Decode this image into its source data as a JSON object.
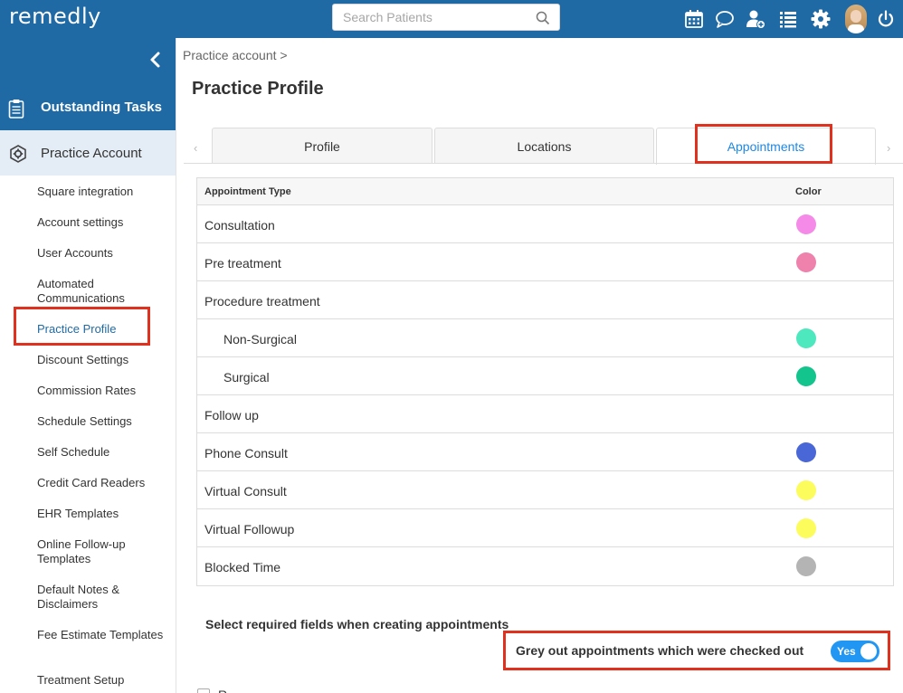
{
  "app": {
    "logo": "remedly"
  },
  "search": {
    "placeholder": "Search Patients"
  },
  "sidebar": {
    "outstanding_tasks": "Outstanding Tasks",
    "practice_account": "Practice Account",
    "items": [
      "Square integration",
      "Account settings",
      "User Accounts",
      "Automated Communications",
      "Practice Profile",
      "Discount Settings",
      "Commission Rates",
      "Schedule Settings",
      "Self Schedule",
      "Credit Card Readers",
      "EHR Templates",
      "Online Follow-up Templates",
      "Default Notes & Disclaimers",
      "Fee Estimate Templates",
      "Treatment Setup"
    ],
    "active_item": "Practice Profile"
  },
  "breadcrumb": "Practice account  >",
  "page_title": "Practice Profile",
  "tabs": [
    {
      "label": "Profile",
      "active": false
    },
    {
      "label": "Locations",
      "active": false
    },
    {
      "label": "Appointments",
      "active": true
    }
  ],
  "table": {
    "headers": {
      "type": "Appointment Type",
      "color": "Color"
    },
    "rows": [
      {
        "name": "Consultation",
        "color": "#f58ae8",
        "indent": false
      },
      {
        "name": "Pre treatment",
        "color": "#ee82ad",
        "indent": false
      },
      {
        "name": "Procedure treatment",
        "color": "",
        "indent": false
      },
      {
        "name": "Non-Surgical",
        "color": "#4ee8bf",
        "indent": true
      },
      {
        "name": "Surgical",
        "color": "#14c48d",
        "indent": true
      },
      {
        "name": "Follow up",
        "color": "",
        "indent": false
      },
      {
        "name": "Phone Consult",
        "color": "#4967d6",
        "indent": false
      },
      {
        "name": "Virtual Consult",
        "color": "#fcfc5c",
        "indent": false
      },
      {
        "name": "Virtual Followup",
        "color": "#fcfc5c",
        "indent": false
      },
      {
        "name": "Blocked Time",
        "color": "#b4b4b4",
        "indent": false
      }
    ]
  },
  "required_fields_title": "Select required fields when creating appointments",
  "grey_out": {
    "label": "Grey out appointments which were checked out",
    "toggle_label": "Yes",
    "enabled": true
  },
  "partial_checkbox_label": "R",
  "colors": {
    "brand": "#1f6aa5",
    "highlight": "#e0301e",
    "tab_active": "#1e88e5",
    "toggle": "#2196f3"
  }
}
